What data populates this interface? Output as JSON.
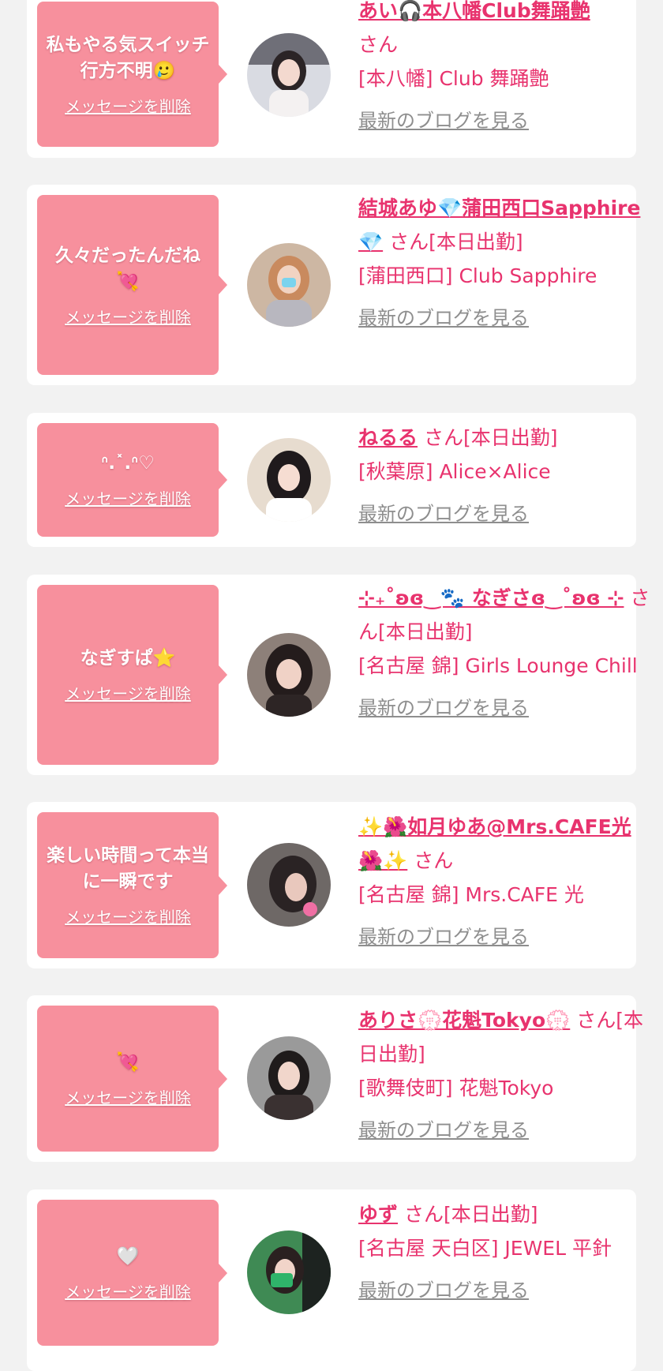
{
  "delete_label": "メッセージを削除",
  "blog_label": "最新のブログを見る",
  "colors": {
    "accent": "#e8336e",
    "bubble": "#f7909d",
    "background": "#f2f2f2",
    "blog_link": "#8e8e8e"
  },
  "cards": [
    {
      "message": "私もやる気スイッチ行方不明🥲",
      "name": "あい🎧本八幡Club舞踊艶",
      "suffix": "さん",
      "shop": "[本八幡] Club 舞踊艶"
    },
    {
      "message": "久々だったんだね💘",
      "name": "結城あゆ💎蒲田西口Sapphire💎",
      "suffix": "さん[本日出勤]",
      "shop": "[蒲田西口] Club Sapphire"
    },
    {
      "message": "ᐢ.˟.ᐢ♡",
      "name": "ねるる",
      "suffix": "さん[本日出勤]",
      "shop": "[秋葉原] Alice×Alice"
    },
    {
      "message": "なぎすぱ⭐",
      "name": "⊹₊˚ʚ︎ɞ‿🐾 なぎさɞ‿˚ʚ︎ɞ ⊹",
      "suffix": "さん[本日出勤]",
      "shop": "[名古屋 錦] Girls Lounge Chill"
    },
    {
      "message": "楽しい時間って本当に一瞬です",
      "name": "✨🌺如月ゆあ@Mrs.CAFE光🌺✨",
      "suffix": "さん",
      "shop": "[名古屋 錦] Mrs.CAFE 光"
    },
    {
      "message": "💘",
      "name": "ありさ💮花魁Tokyo💮",
      "suffix": "さん[本日出勤]",
      "shop": "[歌舞伎町] 花魁Tokyo"
    },
    {
      "message": "🤍",
      "name": "ゆず",
      "suffix": "さん[本日出勤]",
      "shop": "[名古屋 天白区] JEWEL 平針"
    }
  ]
}
